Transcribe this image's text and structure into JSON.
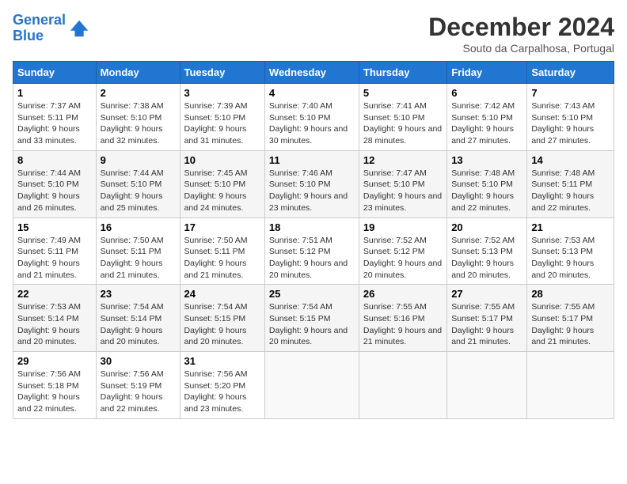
{
  "logo": {
    "line1": "General",
    "line2": "Blue"
  },
  "title": "December 2024",
  "subtitle": "Souto da Carpalhosa, Portugal",
  "days_of_week": [
    "Sunday",
    "Monday",
    "Tuesday",
    "Wednesday",
    "Thursday",
    "Friday",
    "Saturday"
  ],
  "weeks": [
    [
      {
        "day": "1",
        "sunrise": "7:37 AM",
        "sunset": "5:11 PM",
        "daylight": "9 hours and 33 minutes."
      },
      {
        "day": "2",
        "sunrise": "7:38 AM",
        "sunset": "5:10 PM",
        "daylight": "9 hours and 32 minutes."
      },
      {
        "day": "3",
        "sunrise": "7:39 AM",
        "sunset": "5:10 PM",
        "daylight": "9 hours and 31 minutes."
      },
      {
        "day": "4",
        "sunrise": "7:40 AM",
        "sunset": "5:10 PM",
        "daylight": "9 hours and 30 minutes."
      },
      {
        "day": "5",
        "sunrise": "7:41 AM",
        "sunset": "5:10 PM",
        "daylight": "9 hours and 28 minutes."
      },
      {
        "day": "6",
        "sunrise": "7:42 AM",
        "sunset": "5:10 PM",
        "daylight": "9 hours and 27 minutes."
      },
      {
        "day": "7",
        "sunrise": "7:43 AM",
        "sunset": "5:10 PM",
        "daylight": "9 hours and 27 minutes."
      }
    ],
    [
      {
        "day": "8",
        "sunrise": "7:44 AM",
        "sunset": "5:10 PM",
        "daylight": "9 hours and 26 minutes."
      },
      {
        "day": "9",
        "sunrise": "7:44 AM",
        "sunset": "5:10 PM",
        "daylight": "9 hours and 25 minutes."
      },
      {
        "day": "10",
        "sunrise": "7:45 AM",
        "sunset": "5:10 PM",
        "daylight": "9 hours and 24 minutes."
      },
      {
        "day": "11",
        "sunrise": "7:46 AM",
        "sunset": "5:10 PM",
        "daylight": "9 hours and 23 minutes."
      },
      {
        "day": "12",
        "sunrise": "7:47 AM",
        "sunset": "5:10 PM",
        "daylight": "9 hours and 23 minutes."
      },
      {
        "day": "13",
        "sunrise": "7:48 AM",
        "sunset": "5:10 PM",
        "daylight": "9 hours and 22 minutes."
      },
      {
        "day": "14",
        "sunrise": "7:48 AM",
        "sunset": "5:11 PM",
        "daylight": "9 hours and 22 minutes."
      }
    ],
    [
      {
        "day": "15",
        "sunrise": "7:49 AM",
        "sunset": "5:11 PM",
        "daylight": "9 hours and 21 minutes."
      },
      {
        "day": "16",
        "sunrise": "7:50 AM",
        "sunset": "5:11 PM",
        "daylight": "9 hours and 21 minutes."
      },
      {
        "day": "17",
        "sunrise": "7:50 AM",
        "sunset": "5:11 PM",
        "daylight": "9 hours and 21 minutes."
      },
      {
        "day": "18",
        "sunrise": "7:51 AM",
        "sunset": "5:12 PM",
        "daylight": "9 hours and 20 minutes."
      },
      {
        "day": "19",
        "sunrise": "7:52 AM",
        "sunset": "5:12 PM",
        "daylight": "9 hours and 20 minutes."
      },
      {
        "day": "20",
        "sunrise": "7:52 AM",
        "sunset": "5:13 PM",
        "daylight": "9 hours and 20 minutes."
      },
      {
        "day": "21",
        "sunrise": "7:53 AM",
        "sunset": "5:13 PM",
        "daylight": "9 hours and 20 minutes."
      }
    ],
    [
      {
        "day": "22",
        "sunrise": "7:53 AM",
        "sunset": "5:14 PM",
        "daylight": "9 hours and 20 minutes."
      },
      {
        "day": "23",
        "sunrise": "7:54 AM",
        "sunset": "5:14 PM",
        "daylight": "9 hours and 20 minutes."
      },
      {
        "day": "24",
        "sunrise": "7:54 AM",
        "sunset": "5:15 PM",
        "daylight": "9 hours and 20 minutes."
      },
      {
        "day": "25",
        "sunrise": "7:54 AM",
        "sunset": "5:15 PM",
        "daylight": "9 hours and 20 minutes."
      },
      {
        "day": "26",
        "sunrise": "7:55 AM",
        "sunset": "5:16 PM",
        "daylight": "9 hours and 21 minutes."
      },
      {
        "day": "27",
        "sunrise": "7:55 AM",
        "sunset": "5:17 PM",
        "daylight": "9 hours and 21 minutes."
      },
      {
        "day": "28",
        "sunrise": "7:55 AM",
        "sunset": "5:17 PM",
        "daylight": "9 hours and 21 minutes."
      }
    ],
    [
      {
        "day": "29",
        "sunrise": "7:56 AM",
        "sunset": "5:18 PM",
        "daylight": "9 hours and 22 minutes."
      },
      {
        "day": "30",
        "sunrise": "7:56 AM",
        "sunset": "5:19 PM",
        "daylight": "9 hours and 22 minutes."
      },
      {
        "day": "31",
        "sunrise": "7:56 AM",
        "sunset": "5:20 PM",
        "daylight": "9 hours and 23 minutes."
      },
      null,
      null,
      null,
      null
    ]
  ]
}
